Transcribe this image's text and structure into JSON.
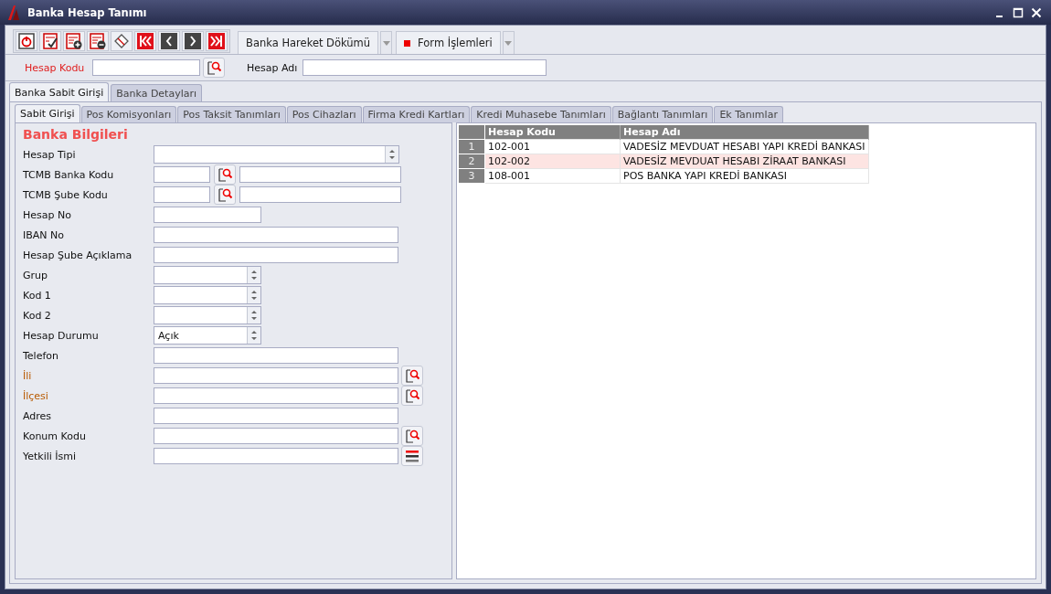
{
  "window": {
    "title": "Banka Hesap Tanımı"
  },
  "toolbar": {
    "buttons": [
      {
        "kind": "power"
      },
      {
        "kind": "check"
      },
      {
        "kind": "add"
      },
      {
        "kind": "remove"
      },
      {
        "kind": "eraser"
      },
      {
        "kind": "first"
      },
      {
        "kind": "prev"
      },
      {
        "kind": "next"
      },
      {
        "kind": "last"
      }
    ],
    "menus": [
      {
        "label": "Banka Hareket Dökümü",
        "marker": false
      },
      {
        "label": "Form İşlemleri",
        "marker": true
      }
    ]
  },
  "header": {
    "code_label": "Hesap Kodu",
    "name_label": "Hesap Adı"
  },
  "tabs": [
    {
      "label": "Banka Sabit Girişi",
      "selected": true
    },
    {
      "label": "Banka Detayları",
      "selected": false
    }
  ],
  "subtabs": [
    {
      "label": "Sabit Girişi",
      "selected": true
    },
    {
      "label": "Pos Komisyonları",
      "selected": false
    },
    {
      "label": "Pos Taksit Tanımları",
      "selected": false
    },
    {
      "label": "Pos Cihazları",
      "selected": false
    },
    {
      "label": "Firma Kredi Kartları",
      "selected": false
    },
    {
      "label": "Kredi Muhasebe Tanımları",
      "selected": false
    },
    {
      "label": "Bağlantı Tanımları",
      "selected": false
    },
    {
      "label": "Ek Tanımlar",
      "selected": false
    }
  ],
  "form": {
    "title": "Banka Bilgileri",
    "fields": [
      {
        "label": "Hesap Tipi",
        "kind": "combo_wide",
        "highlighted": false
      },
      {
        "label": "TCMB Banka Kodu",
        "kind": "lookup_pair",
        "highlighted": false
      },
      {
        "label": "TCMB Şube Kodu",
        "kind": "lookup_pair",
        "highlighted": false
      },
      {
        "label": "Hesap No",
        "kind": "short",
        "highlighted": false
      },
      {
        "label": "IBAN No",
        "kind": "text",
        "highlighted": false
      },
      {
        "label": "Hesap Şube Açıklama",
        "kind": "text",
        "highlighted": false
      },
      {
        "label": "Grup",
        "kind": "combo",
        "highlighted": false
      },
      {
        "label": "Kod 1",
        "kind": "combo",
        "highlighted": false
      },
      {
        "label": "Kod 2",
        "kind": "combo",
        "highlighted": false
      },
      {
        "label": "Hesap Durumu",
        "kind": "combo",
        "value": "Açık",
        "highlighted": false
      },
      {
        "label": "Telefon",
        "kind": "text",
        "highlighted": false
      },
      {
        "label": "İli",
        "kind": "search",
        "highlighted": true
      },
      {
        "label": "İlçesi",
        "kind": "search",
        "highlighted": true
      },
      {
        "label": "Adres",
        "kind": "text",
        "highlighted": false
      },
      {
        "label": "Konum Kodu",
        "kind": "search",
        "highlighted": false
      },
      {
        "label": "Yetkili İsmi",
        "kind": "list",
        "highlighted": false
      }
    ]
  },
  "grid": {
    "columns": [
      "Hesap Kodu",
      "Hesap Adı"
    ],
    "rows": [
      {
        "number": "1",
        "code": "102-001",
        "name": "VADESİZ MEVDUAT HESABI YAPI KREDİ BANKASI",
        "selected": false
      },
      {
        "number": "2",
        "code": "102-002",
        "name": "VADESİZ MEVDUAT HESABI ZİRAAT BANKASI",
        "selected": true
      },
      {
        "number": "3",
        "code": "108-001",
        "name": "POS BANKA YAPI KREDİ BANKASI",
        "selected": false
      }
    ]
  }
}
